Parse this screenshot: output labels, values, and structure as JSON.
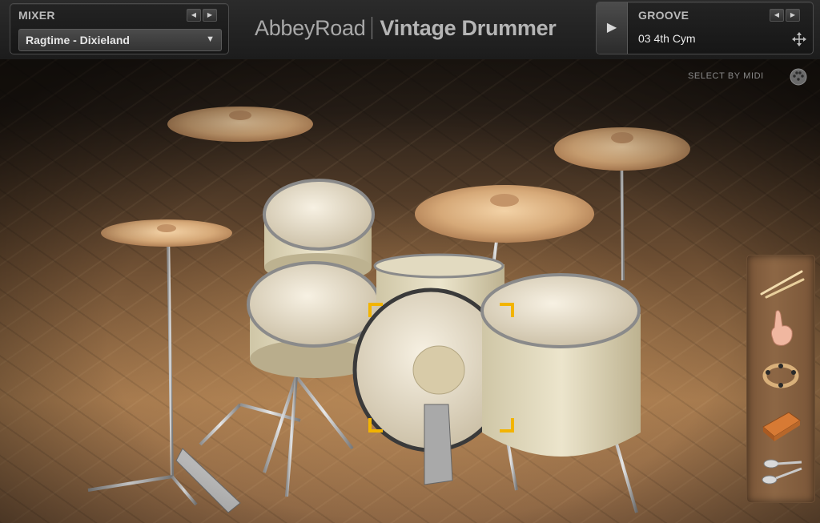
{
  "mixer": {
    "title": "MIXER",
    "preset": "Ragtime - Dixieland"
  },
  "brand": {
    "abbey": "Abbey",
    "road": "Road",
    "product": "Vintage Drummer"
  },
  "groove": {
    "title": "GROOVE",
    "name": "03 4th Cym"
  },
  "select_by_midi": "SELECT BY MIDI",
  "sidebar": {
    "items": [
      {
        "icon": "drumsticks-icon"
      },
      {
        "icon": "hand-icon"
      },
      {
        "icon": "tambourine-icon"
      },
      {
        "icon": "woodblock-icon"
      },
      {
        "icon": "spoons-icon"
      }
    ]
  },
  "colors": {
    "accent": "#f2b400",
    "panel": "#1c1c1c"
  }
}
